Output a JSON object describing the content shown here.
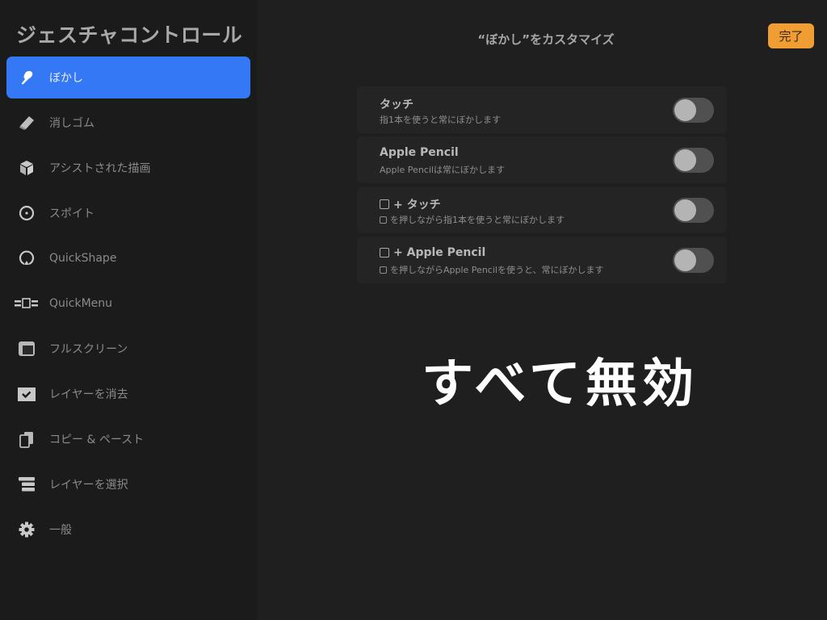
{
  "sidebar": {
    "title": "ジェスチャコントロール",
    "items": [
      {
        "label": "ぼかし",
        "icon": "smudge-icon",
        "active": true
      },
      {
        "label": "消しゴム",
        "icon": "eraser-icon"
      },
      {
        "label": "アシストされた描画",
        "icon": "cube-icon"
      },
      {
        "label": "スポイト",
        "icon": "eyedropper-icon"
      },
      {
        "label": "QuickShape",
        "icon": "quickshape-icon"
      },
      {
        "label": "QuickMenu",
        "icon": "quickmenu-icon"
      },
      {
        "label": "フルスクリーン",
        "icon": "fullscreen-icon"
      },
      {
        "label": "レイヤーを消去",
        "icon": "clear-layer-icon"
      },
      {
        "label": "コピー & ペースト",
        "icon": "copy-paste-icon"
      },
      {
        "label": "レイヤーを選択",
        "icon": "select-layer-icon"
      },
      {
        "label": "一般",
        "icon": "gear-icon"
      }
    ]
  },
  "main": {
    "title": "“ぼかし”をカスタマイズ",
    "done_label": "完了",
    "options": [
      {
        "title": "タッチ",
        "subtitle": "指1本を使うと常にぼかします",
        "modifier": false,
        "enabled": false
      },
      {
        "title": "Apple Pencil",
        "subtitle": "Apple Pencilは常にぼかします",
        "modifier": false,
        "enabled": false
      },
      {
        "title": "+ タッチ",
        "subtitle": "を押しながら指1本を使うと常にぼかします",
        "modifier": true,
        "enabled": false
      },
      {
        "title": "+ Apple Pencil",
        "subtitle": "を押しながらApple Pencilを使うと、常にぼかします",
        "modifier": true,
        "enabled": false
      }
    ]
  },
  "annotation": "すべて無効",
  "colors": {
    "accent": "#3478f6",
    "done_button": "#f09d34"
  }
}
